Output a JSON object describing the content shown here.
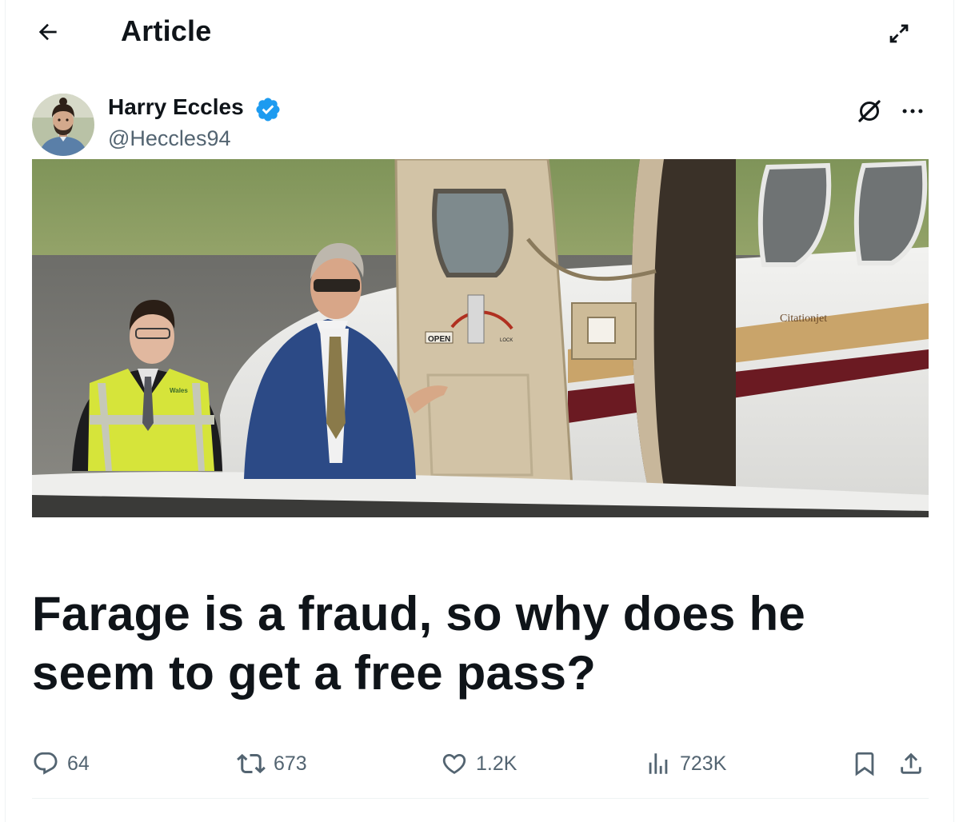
{
  "header": {
    "title": "Article",
    "back_icon": "arrow-left-icon",
    "expand_icon": "expand-icon"
  },
  "author": {
    "name": "Harry Eccles",
    "handle": "@Heccles94",
    "verified": true,
    "verified_color": "#1d9bf0"
  },
  "cover_image": {
    "plane_label": "Citationjet",
    "door_open_label": "OPEN",
    "door_lock_label": "LOCK",
    "vest_label": "Wales"
  },
  "article": {
    "title": "Farage is a fraud, so why does he seem to get a free pass?"
  },
  "actions": {
    "replies": "64",
    "reposts": "673",
    "likes": "1.2K",
    "views": "723K"
  },
  "colors": {
    "text_primary": "#0f1419",
    "text_secondary": "#536471",
    "accent": "#1d9bf0"
  }
}
